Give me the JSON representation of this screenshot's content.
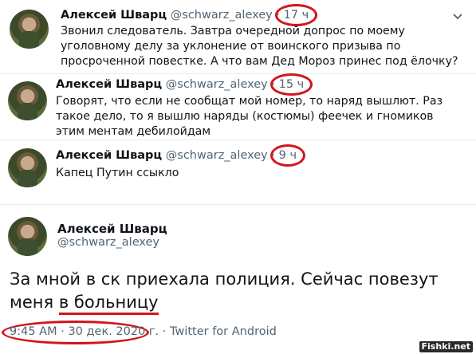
{
  "tweets": [
    {
      "name": "Алексей Шварц",
      "handle": "@schwarz_alexey",
      "dot": "·",
      "time": "17 ч",
      "text": "Звонил следователь. Завтра очередной допрос по моему уголовному делу за уклонение от воинского призыва по просроченной повестке. А что вам Дед Мороз принес под ёлочку?"
    },
    {
      "name": "Алексей Шварц",
      "handle": "@schwarz_alexey",
      "dot": "·",
      "time": "15 ч",
      "text": "Говорят, что если не сообщат мой номер, то наряд вышлют. Раз такое дело, то я вышлю наряды (костюмы) феечек и гномиков этим ментам дебилойдам"
    },
    {
      "name": "Алексей Шварц",
      "handle": "@schwarz_alexey",
      "dot": "·",
      "time": "9 ч",
      "text": "Капец Путин ссыкло"
    }
  ],
  "main_tweet": {
    "name": "Алексей Шварц",
    "handle": "@schwarz_alexey",
    "text_before": "За мной в ск приехала полиция. Сейчас повезут меня ",
    "text_underlined": "в больницу",
    "time": "9:45 AM",
    "date": "30 дек. 2020 г.",
    "source": "Twitter for Android"
  },
  "watermark": "Fishki.net",
  "colors": {
    "annotation_red": "#d2151b",
    "secondary_text": "#536471"
  },
  "icons": {
    "more": "chevron-down-icon"
  }
}
